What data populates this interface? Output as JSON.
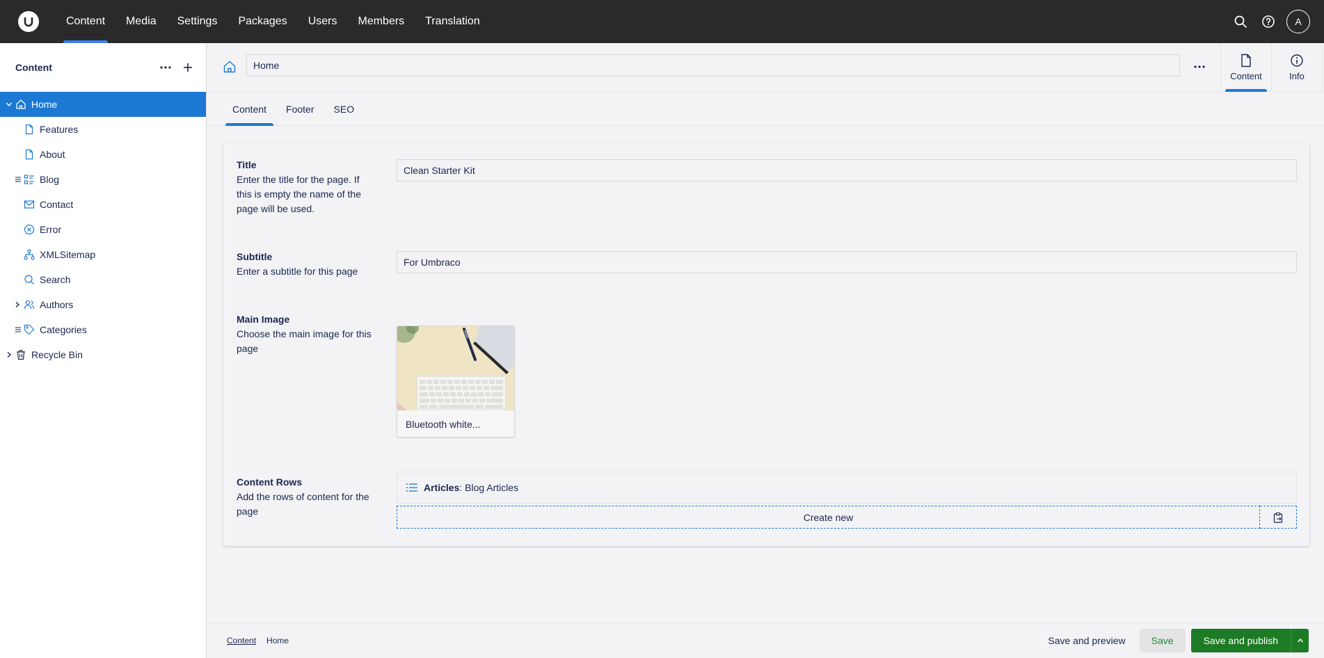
{
  "topbar": {
    "nav": [
      "Content",
      "Media",
      "Settings",
      "Packages",
      "Users",
      "Members",
      "Translation"
    ],
    "active_nav": "Content",
    "avatar_initial": "A"
  },
  "sidebar": {
    "title": "Content",
    "tree": [
      {
        "label": "Home",
        "icon": "home-icon",
        "active": true,
        "expanded": true
      },
      {
        "label": "Features",
        "icon": "document-icon"
      },
      {
        "label": "About",
        "icon": "document-icon"
      },
      {
        "label": "Blog",
        "icon": "list-icon",
        "draggable": true
      },
      {
        "label": "Contact",
        "icon": "mail-icon"
      },
      {
        "label": "Error",
        "icon": "error-circle-icon"
      },
      {
        "label": "XMLSitemap",
        "icon": "sitemap-icon"
      },
      {
        "label": "Search",
        "icon": "search-icon"
      },
      {
        "label": "Authors",
        "icon": "users-icon",
        "collapsed": true
      },
      {
        "label": "Categories",
        "icon": "tag-icon",
        "draggable": true
      },
      {
        "label": "Recycle Bin",
        "icon": "trash-icon",
        "root": true
      }
    ]
  },
  "header": {
    "name_value": "Home",
    "views": [
      {
        "label": "Content",
        "icon": "document-icon",
        "active": true
      },
      {
        "label": "Info",
        "icon": "info-icon"
      }
    ]
  },
  "tabs": [
    "Content",
    "Footer",
    "SEO"
  ],
  "properties": {
    "title": {
      "label": "Title",
      "description": "Enter the title for the page. If this is empty the name of the page will be used.",
      "value": "Clean Starter Kit"
    },
    "subtitle": {
      "label": "Subtitle",
      "description": "Enter a subtitle for this page",
      "value": "For Umbraco"
    },
    "main_image": {
      "label": "Main Image",
      "description": "Choose the main image for this page",
      "media_name": "Bluetooth white..."
    },
    "content_rows": {
      "label": "Content Rows",
      "description": "Add the rows of content for the page",
      "block_type": "Articles",
      "block_name": ": Blog Articles",
      "create_label": "Create new"
    }
  },
  "footer": {
    "breadcrumbs": [
      "Content",
      "Home"
    ],
    "save_preview": "Save and preview",
    "save": "Save",
    "save_publish": "Save and publish"
  },
  "colors": {
    "topbar": "#2a2a2a",
    "accent": "#1b79d3",
    "publish": "#1e7b25",
    "text": "#1b264f"
  }
}
